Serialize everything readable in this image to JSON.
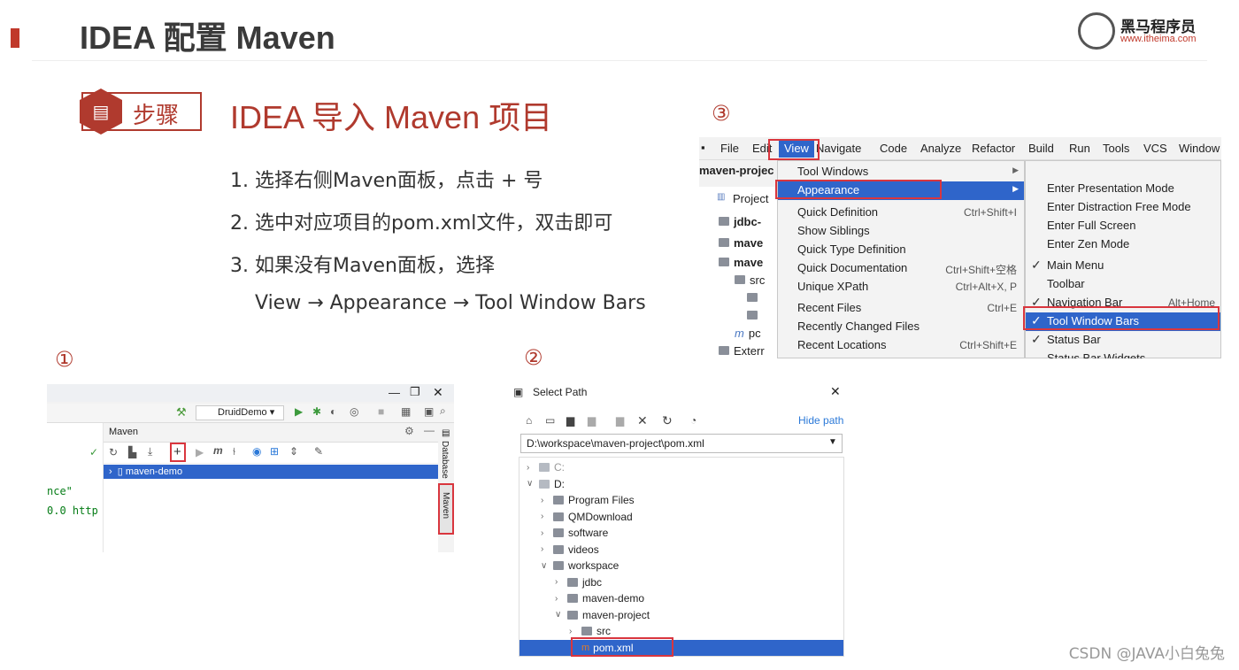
{
  "header": {
    "title": "IDEA 配置 Maven",
    "logo_text": "黑马程序员",
    "logo_url": "www.itheima.com"
  },
  "step": {
    "label": "步骤",
    "title": "IDEA 导入 Maven 项目"
  },
  "instructions": [
    "1.  选择右侧Maven面板，点击 + 号",
    "2.  选中对应项目的pom.xml文件，双击即可",
    "3.  如果没有Maven面板，选择",
    "View → Appearance → Tool Window Bars"
  ],
  "markers": {
    "one": "①",
    "two": "②",
    "three": "③"
  },
  "shot1": {
    "config": "DruidDemo",
    "panel_title": "Maven",
    "project": "maven-demo",
    "code1": "nce\"",
    "code2": "0.0 http",
    "side_database": "Database",
    "side_maven": "Maven"
  },
  "shot2": {
    "title": "Select Path",
    "hide": "Hide path",
    "path": "D:\\workspace\\maven-project\\pom.xml",
    "tree": [
      {
        "label": "C:",
        "indent": 0,
        "open": false,
        "folder": false
      },
      {
        "label": "D:",
        "indent": 0,
        "open": true,
        "folder": false
      },
      {
        "label": "Program Files",
        "indent": 1,
        "open": false,
        "folder": true
      },
      {
        "label": "QMDownload",
        "indent": 1,
        "open": false,
        "folder": true
      },
      {
        "label": "software",
        "indent": 1,
        "open": false,
        "folder": true
      },
      {
        "label": "videos",
        "indent": 1,
        "open": false,
        "folder": true
      },
      {
        "label": "workspace",
        "indent": 1,
        "open": true,
        "folder": true
      },
      {
        "label": "jdbc",
        "indent": 2,
        "open": false,
        "folder": true
      },
      {
        "label": "maven-demo",
        "indent": 2,
        "open": false,
        "folder": true
      },
      {
        "label": "maven-project",
        "indent": 2,
        "open": true,
        "folder": true
      },
      {
        "label": "src",
        "indent": 3,
        "open": false,
        "folder": true
      },
      {
        "label": "pom.xml",
        "indent": 3,
        "open": null,
        "folder": false
      }
    ]
  },
  "shot3": {
    "menubar": [
      "File",
      "Edit",
      "View",
      "Navigate",
      "Code",
      "Analyze",
      "Refactor",
      "Build",
      "Run",
      "Tools",
      "VCS",
      "Window",
      "H"
    ],
    "project": "maven-projec",
    "project_tab": "Project",
    "left_tree": [
      "jdbc-",
      "mave",
      "mave",
      "src",
      "",
      "",
      "pc",
      "Exterr"
    ],
    "view_menu": [
      {
        "label": "Tool Windows",
        "sc": ""
      },
      {
        "label": "Appearance",
        "sc": ""
      },
      {
        "label": "Quick Definition",
        "sc": "Ctrl+Shift+I"
      },
      {
        "label": "Show Siblings",
        "sc": ""
      },
      {
        "label": "Quick Type Definition",
        "sc": ""
      },
      {
        "label": "Quick Documentation",
        "sc": "Ctrl+Shift+空格"
      },
      {
        "label": "Unique XPath",
        "sc": "Ctrl+Alt+X, P"
      },
      {
        "label": "Recent Files",
        "sc": "Ctrl+E"
      },
      {
        "label": "Recently Changed Files",
        "sc": ""
      },
      {
        "label": "Recent Locations",
        "sc": "Ctrl+Shift+E"
      }
    ],
    "appearance_menu": [
      {
        "label": "Enter Presentation Mode",
        "check": false,
        "sc": ""
      },
      {
        "label": "Enter Distraction Free Mode",
        "check": false,
        "sc": ""
      },
      {
        "label": "Enter Full Screen",
        "check": false,
        "sc": ""
      },
      {
        "label": "Enter Zen Mode",
        "check": false,
        "sc": ""
      },
      {
        "label": "Main Menu",
        "check": true,
        "sc": ""
      },
      {
        "label": "Toolbar",
        "check": false,
        "sc": ""
      },
      {
        "label": "Navigation Bar",
        "check": true,
        "sc": "Alt+Home"
      },
      {
        "label": "Tool Window Bars",
        "check": true,
        "sc": ""
      },
      {
        "label": "Status Bar",
        "check": true,
        "sc": ""
      },
      {
        "label": "Status Bar Widgets",
        "check": false,
        "sc": ""
      }
    ]
  },
  "watermark": "CSDN @JAVA小白兔兔",
  "colors": {
    "accent": "#b03a2e",
    "highlight": "#2f65ca",
    "redbox": "#d9363e"
  }
}
